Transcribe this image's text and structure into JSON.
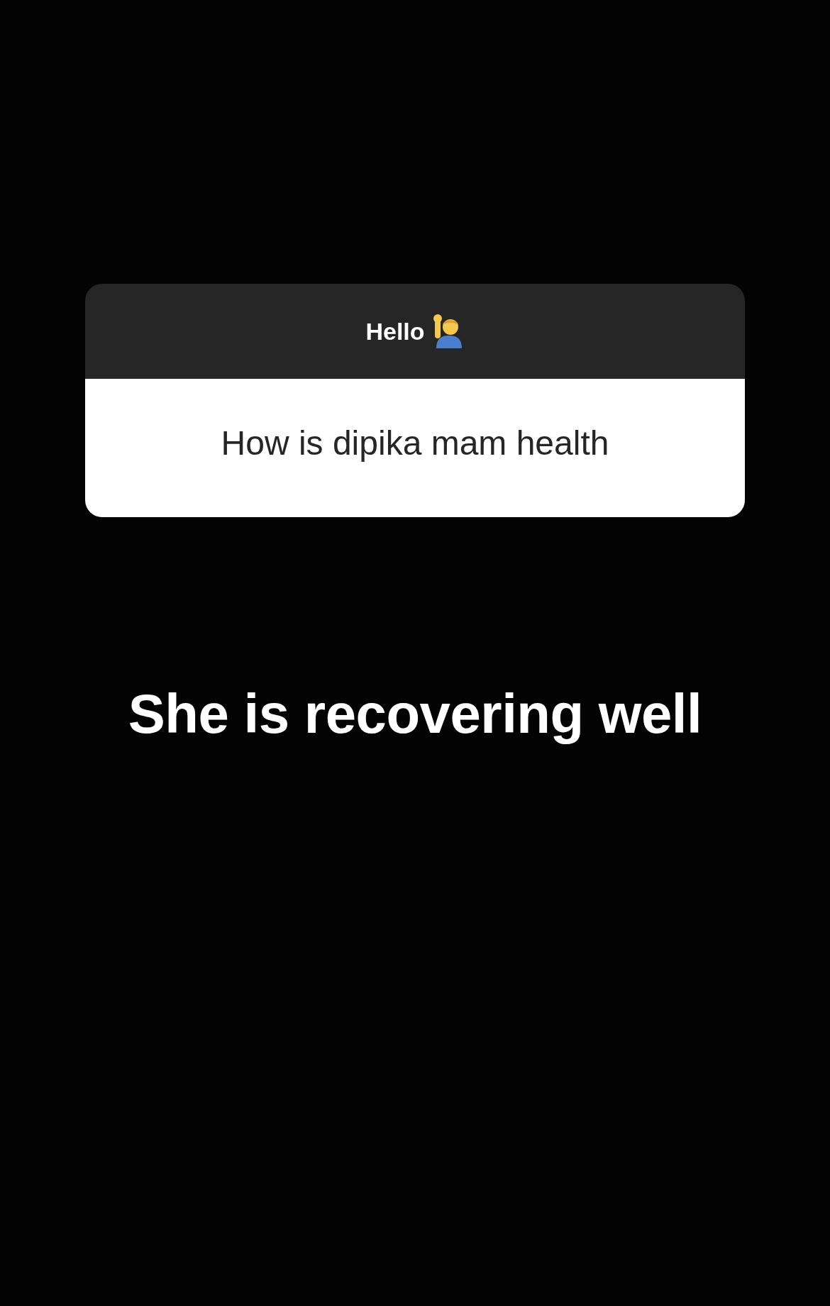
{
  "question_card": {
    "header": "Hello",
    "question": "How is dipika mam health"
  },
  "answer": "She is recovering well"
}
